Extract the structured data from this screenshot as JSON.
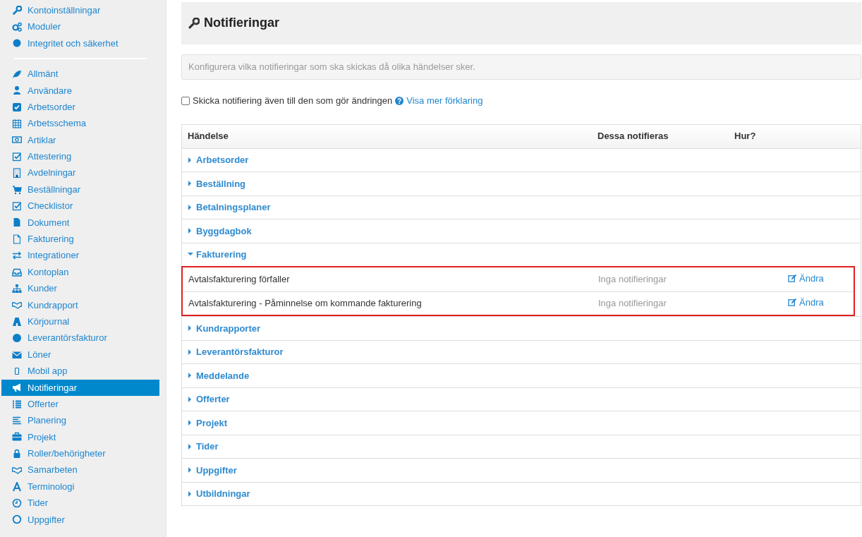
{
  "sidebar": {
    "groups": [
      {
        "items": [
          {
            "label": "Kontoinställningar",
            "selected": false
          },
          {
            "label": "Moduler",
            "selected": false
          },
          {
            "label": "Integritet och säkerhet",
            "selected": false
          }
        ]
      },
      {
        "items": [
          {
            "label": "Allmänt",
            "selected": false
          },
          {
            "label": "Användare",
            "selected": false
          },
          {
            "label": "Arbetsorder",
            "selected": false
          },
          {
            "label": "Arbetsschema",
            "selected": false
          },
          {
            "label": "Artiklar",
            "selected": false
          },
          {
            "label": "Attestering",
            "selected": false
          },
          {
            "label": "Avdelningar",
            "selected": false
          },
          {
            "label": "Beställningar",
            "selected": false
          },
          {
            "label": "Checklistor",
            "selected": false
          },
          {
            "label": "Dokument",
            "selected": false
          },
          {
            "label": "Fakturering",
            "selected": false
          },
          {
            "label": "Integrationer",
            "selected": false
          },
          {
            "label": "Kontoplan",
            "selected": false
          },
          {
            "label": "Kunder",
            "selected": false
          },
          {
            "label": "Kundrapport",
            "selected": false
          },
          {
            "label": "Körjournal",
            "selected": false
          },
          {
            "label": "Leverantörsfakturor",
            "selected": false
          },
          {
            "label": "Löner",
            "selected": false
          },
          {
            "label": "Mobil app",
            "selected": false
          },
          {
            "label": "Notifieringar",
            "selected": true
          },
          {
            "label": "Offerter",
            "selected": false
          },
          {
            "label": "Planering",
            "selected": false
          },
          {
            "label": "Projekt",
            "selected": false
          },
          {
            "label": "Roller/behörigheter",
            "selected": false
          },
          {
            "label": "Samarbeten",
            "selected": false
          },
          {
            "label": "Terminologi",
            "selected": false
          },
          {
            "label": "Tider",
            "selected": false
          },
          {
            "label": "Uppgifter",
            "selected": false
          }
        ]
      }
    ]
  },
  "page": {
    "title": "Notifieringar",
    "info": "Konfigurera vilka notifieringar som ska skickas då olika händelser sker.",
    "checkbox": {
      "label": "Skicka notifiering även till den som gör ändringen",
      "checked": false
    },
    "help_link": "Visa mer förklaring"
  },
  "table": {
    "columns": [
      "Händelse",
      "Dessa notifieras",
      "Hur?"
    ],
    "groups": [
      {
        "label": "Arbetsorder",
        "expanded": false
      },
      {
        "label": "Beställning",
        "expanded": false
      },
      {
        "label": "Betalningsplaner",
        "expanded": false
      },
      {
        "label": "Byggdagbok",
        "expanded": false
      },
      {
        "label": "Fakturering",
        "expanded": true,
        "highlighted": true,
        "rows": [
          {
            "event": "Avtalsfakturering förfaller",
            "recipients": "Inga notifieringar",
            "action": "Ändra"
          },
          {
            "event": "Avtalsfakturering - Påminnelse om kommande fakturering",
            "recipients": "Inga notifieringar",
            "action": "Ändra"
          }
        ]
      },
      {
        "label": "Kundrapporter",
        "expanded": false
      },
      {
        "label": "Leverantörsfakturor",
        "expanded": false
      },
      {
        "label": "Meddelande",
        "expanded": false
      },
      {
        "label": "Offerter",
        "expanded": false
      },
      {
        "label": "Projekt",
        "expanded": false
      },
      {
        "label": "Tider",
        "expanded": false
      },
      {
        "label": "Uppgifter",
        "expanded": false
      },
      {
        "label": "Utbildningar",
        "expanded": false
      }
    ]
  }
}
